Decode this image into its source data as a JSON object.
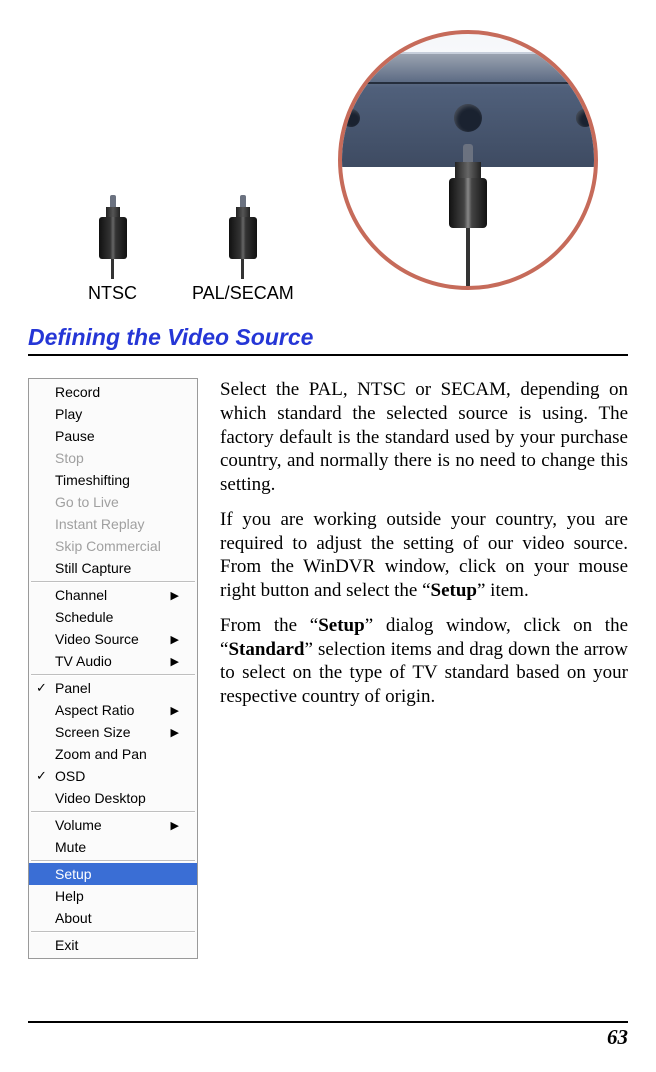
{
  "figure": {
    "plug_labels": [
      "NTSC",
      "PAL/SECAM"
    ]
  },
  "heading": "Defining the Video Source",
  "menu": {
    "groups": [
      [
        {
          "label": "Record",
          "disabled": false
        },
        {
          "label": "Play",
          "disabled": false
        },
        {
          "label": "Pause",
          "disabled": false
        },
        {
          "label": "Stop",
          "disabled": true
        },
        {
          "label": "Timeshifting",
          "disabled": false
        },
        {
          "label": "Go to Live",
          "disabled": true
        },
        {
          "label": "Instant Replay",
          "disabled": true
        },
        {
          "label": "Skip Commercial",
          "disabled": true
        },
        {
          "label": "Still Capture",
          "disabled": false
        }
      ],
      [
        {
          "label": "Channel",
          "submenu": true
        },
        {
          "label": "Schedule"
        },
        {
          "label": "Video Source",
          "submenu": true
        },
        {
          "label": "TV Audio",
          "submenu": true
        }
      ],
      [
        {
          "label": "Panel",
          "checked": true
        },
        {
          "label": "Aspect Ratio",
          "submenu": true
        },
        {
          "label": "Screen Size",
          "submenu": true
        },
        {
          "label": "Zoom and Pan"
        },
        {
          "label": "OSD",
          "checked": true
        },
        {
          "label": "Video Desktop"
        }
      ],
      [
        {
          "label": "Volume",
          "submenu": true
        },
        {
          "label": "Mute"
        }
      ],
      [
        {
          "label": "Setup",
          "selected": true
        },
        {
          "label": "Help"
        },
        {
          "label": "About"
        }
      ],
      [
        {
          "label": "Exit"
        }
      ]
    ]
  },
  "paragraphs": {
    "p1": "Select the PAL, NTSC or SECAM, depending on which standard the selected source is using. The factory default is the standard used by your purchase country, and normally there is no need to change this setting.",
    "p2_a": "If you are working outside your country, you are required to adjust the setting of our video source.  From the WinDVR window, click on your mouse right button and select the “",
    "p2_b": "Setup",
    "p2_c": "” item.",
    "p3_a": "From the “",
    "p3_b": "Setup",
    "p3_c": "” dialog window, click on the “",
    "p3_d": "Standard",
    "p3_e": "” selection items and drag down the arrow to select on the type of TV standard based on your respective country of origin."
  },
  "page_number": "63"
}
